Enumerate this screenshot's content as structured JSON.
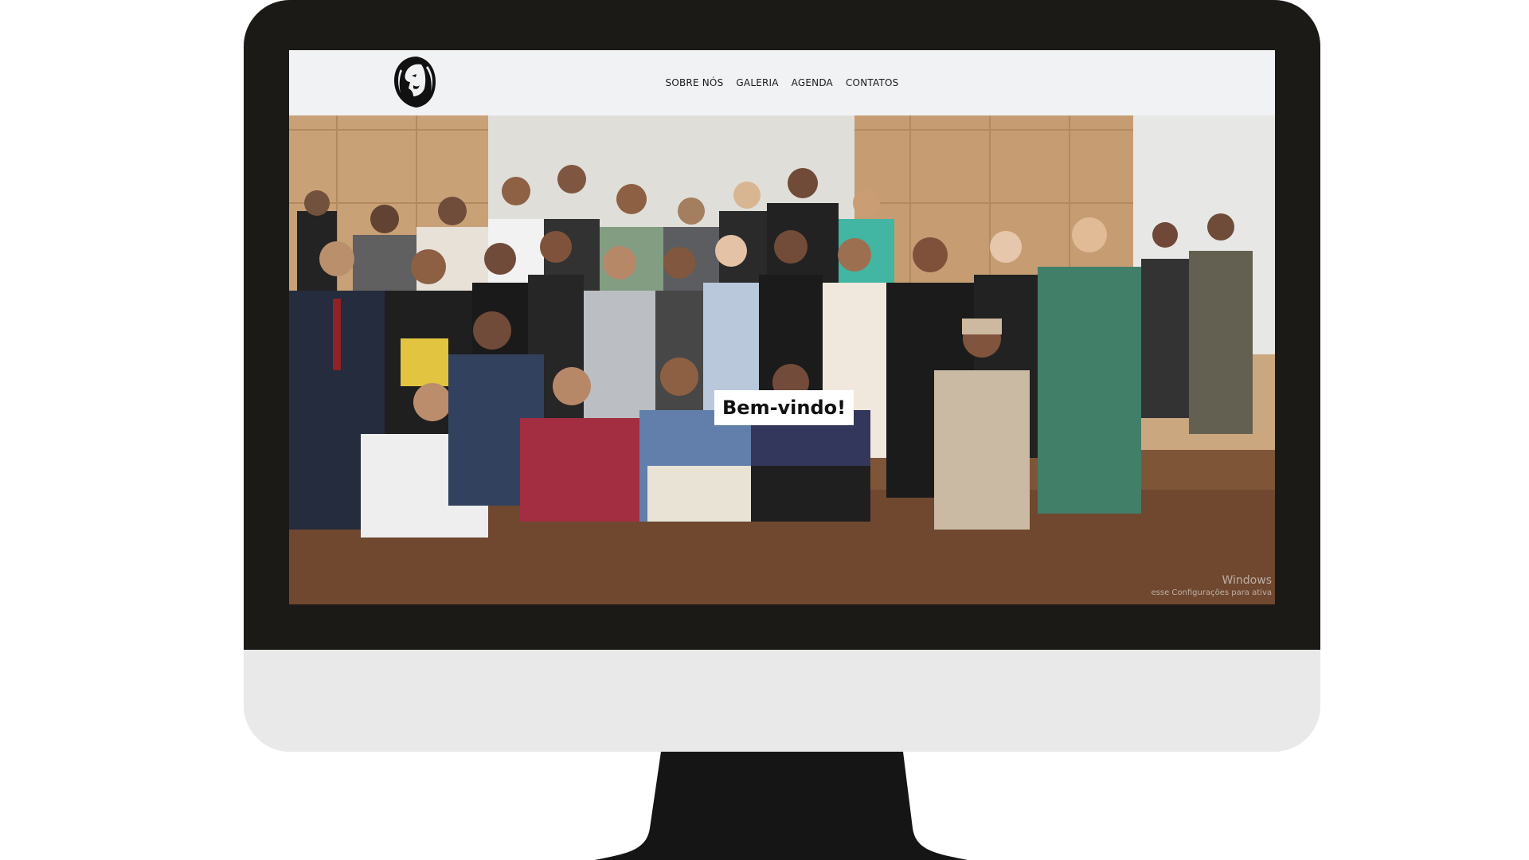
{
  "site": {
    "logo_icon": "lion-head-icon",
    "nav": [
      {
        "label": "SOBRE NÓS"
      },
      {
        "label": "GALERIA"
      },
      {
        "label": "AGENDA"
      },
      {
        "label": "CONTATOS"
      }
    ]
  },
  "hero": {
    "welcome_text": "Bem-vindo!",
    "photo_description_icon": "group-photo"
  },
  "os_watermark": {
    "title": "Windows",
    "subtitle": "esse Configurações para ativa"
  },
  "colors": {
    "bezel": "#1c1a17",
    "chin": "#e8e9e8",
    "header_bg": "#f1f2f4",
    "welcome_bg": "#ffffff"
  }
}
